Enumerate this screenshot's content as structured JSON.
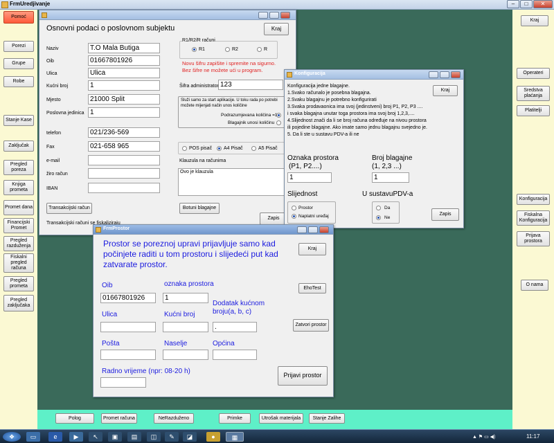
{
  "app": {
    "title": "FrmUredjivanje"
  },
  "left_menu": [
    {
      "label": "Pomoć"
    },
    {
      "label": "Porezi"
    },
    {
      "label": "Grupe"
    },
    {
      "label": "Robe"
    },
    {
      "label": "Stanje Kase"
    },
    {
      "label": "Zaključak"
    },
    {
      "label": "Pregled poreza"
    },
    {
      "label": "Knjiga prometa"
    },
    {
      "label": "Promet dana"
    },
    {
      "label": "Financijski Promet"
    },
    {
      "label": "Pregled razduženja"
    },
    {
      "label": "Fiskalni pregled računa"
    },
    {
      "label": "Pregled prometa"
    },
    {
      "label": "Pregled zaključaka"
    }
  ],
  "right_menu": [
    {
      "label": "Kraj"
    },
    {
      "label": "Operateri"
    },
    {
      "label": "Sredstva plaćanja"
    },
    {
      "label": "Platitelji"
    },
    {
      "label": "Konfiguracija"
    },
    {
      "label": "Fiskalna Konfiguracija"
    },
    {
      "label": "Prijava prostora"
    },
    {
      "label": "O nama"
    }
  ],
  "bottom_menu": [
    {
      "label": "Polog"
    },
    {
      "label": "Promet računa"
    },
    {
      "label": "NeRazduženo"
    },
    {
      "label": "Primke"
    },
    {
      "label": "Utrošak materijala"
    },
    {
      "label": "Stanje Zalihe"
    }
  ],
  "company": {
    "heading": "Osnovni podaci  o poslovnom subjektu",
    "kraj": "Kraj",
    "fields": [
      {
        "label": "Naziv",
        "value": "T.O Mala Butiga"
      },
      {
        "label": "Oib",
        "value": "01667801926"
      },
      {
        "label": "Ulica",
        "value": "Ulica"
      },
      {
        "label": "Kućni broj",
        "value": "1"
      },
      {
        "label": "Mjesto",
        "value": "21000 Split"
      },
      {
        "label": "Poslovna jedinica",
        "value": "1"
      },
      {
        "label": "telefon",
        "value": "021/236-569"
      },
      {
        "label": "Fax",
        "value": "021-658 965"
      },
      {
        "label": "e-mail",
        "value": ""
      },
      {
        "label": "žiro račun",
        "value": ""
      },
      {
        "label": "IBAN",
        "value": ""
      }
    ],
    "r_group": {
      "title": "R1/R2/R računi",
      "options": [
        "R1",
        "R2",
        "R"
      ]
    },
    "warning_1": "Novu šifru zapišite i spremite na sigurno.",
    "warning_2": "Bez šifre ne možete ući u program.",
    "admin_label": "Šifra administratora",
    "admin_value": "123",
    "start_note_1": "Služi samo za start aplikacije. U toku rada po potrebi",
    "start_note_2": "možete mijenjati način unos količine",
    "qty_opt_1": "Podrazumjevana količina =1",
    "qty_opt_2": "Blagajnik unosi količinu",
    "printers": [
      "POS pisač",
      "A4 Pisač",
      "A5 Pisač"
    ],
    "clause_label": "Klauzula na računima",
    "clause_text": "Ovo je klauzula",
    "trans_btn": "Transakcijski račun",
    "trans_note": "Transakcijski računi se fiskaliziraju",
    "botuni_btn": "Botuni blagajne",
    "zapis_btn": "Zapis"
  },
  "config": {
    "title": "Konfiguracija",
    "kraj": "Kraj",
    "lines": [
      "Konfiguracija jedne blagajne.",
      "1.Svako računalo je posebna blagajna.",
      "2.Svaku blagajnu je potrebno konfigurirati",
      "3.Svaka prodavaonica ima svoj (jedinstveni)  broj P1, P2, P3 ....",
      "i svaka blagajna unutar toga prostora ima svoj broj 1,2,3,....",
      "4.Slijednost znači da li se broj računa određuje na nivou prostora",
      "ili  pojedine blagajne. Ako imate samo jednu blagajnu svejedno je.",
      "5. Da li ste u sustavu PDV-a ili ne"
    ],
    "oznaka_label_1": "Oznaka prostora",
    "oznaka_label_2": "(P1, P2....)",
    "oznaka_value": "1",
    "broj_label_1": "Broj blagajne",
    "broj_label_2": "(1, 2,3 ...)",
    "broj_value": "1",
    "slijednost": "Slijednost",
    "slijednost_opts": [
      "Prostor",
      "Naplatni uređaj"
    ],
    "pdv": "U sustavuPDV-a",
    "pdv_opts": [
      "Da",
      "Ne"
    ],
    "zapis": "Zapis"
  },
  "prostor": {
    "title": "FrmProstor",
    "intro": "Prostor se poreznoj upravi prijavljuje samo kad počinjete raditi u tom prostoru i  slijedeći put kad zatvarate  prostor.",
    "kraj": "Kraj",
    "oib_label": "Oib",
    "oib_value": "01667801926",
    "oznaka_label": "oznaka prostora",
    "oznaka_value": "1",
    "ehotest": "EhoTest",
    "ulica_label": "Ulica",
    "ulica_value": "",
    "kbroj_label": "Kućni broj",
    "kbroj_value": "",
    "dodatak_label": "Dodatak kućnom broju(a, b, c)",
    "dodatak_value": ".",
    "zatvori": "Zatvori prostor",
    "posta_label": "Pošta",
    "posta_value": "",
    "naselje_label": "Naselje",
    "naselje_value": "",
    "opcina_label": "Općina",
    "opcina_value": "",
    "radno_label": "Radno vrijeme (npr:  08-20 h)",
    "radno_value": "",
    "prijavi": "Prijavi prostor"
  },
  "taskbar": {
    "time": "11:17"
  }
}
